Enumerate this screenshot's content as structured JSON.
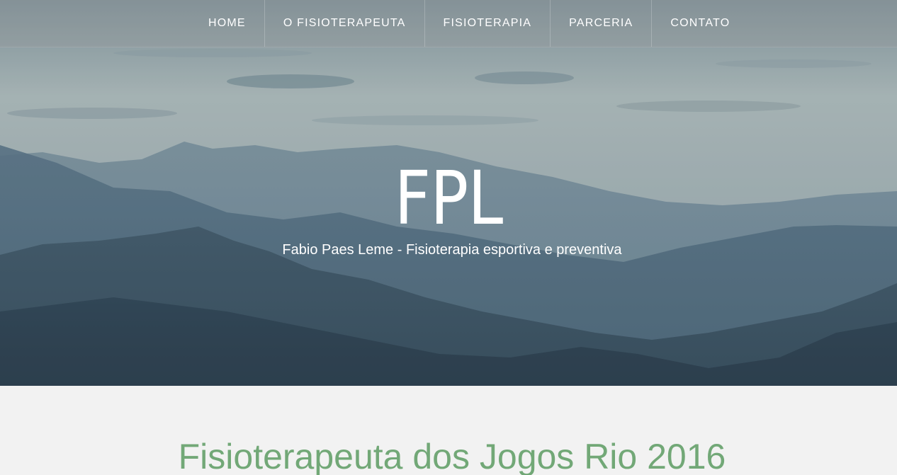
{
  "nav": {
    "items": [
      {
        "label": "HOME"
      },
      {
        "label": "O FISIOTERAPEUTA"
      },
      {
        "label": "FISIOTERAPIA"
      },
      {
        "label": "PARCERIA"
      },
      {
        "label": "CONTATO"
      }
    ]
  },
  "hero": {
    "title": "FPL",
    "subtitle": "Fabio Paes Leme - Fisioterapia esportiva e preventiva"
  },
  "main": {
    "section_title": "Fisioterapeuta dos Jogos Rio 2016"
  },
  "colors": {
    "accent_green": "#72a877",
    "background": "#f2f2f2",
    "nav_text": "#ffffff"
  }
}
